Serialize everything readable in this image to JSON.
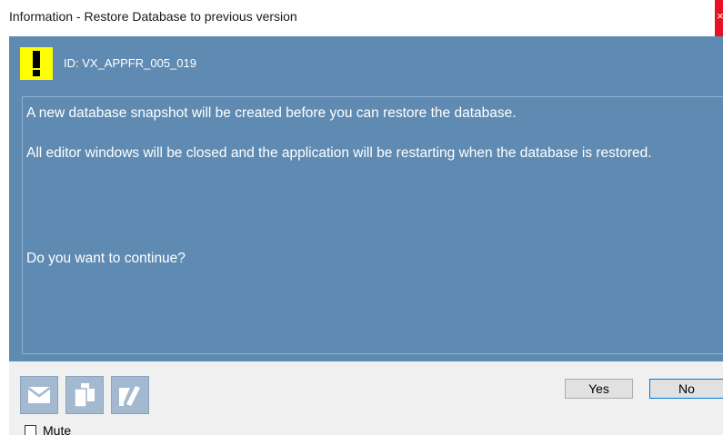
{
  "window": {
    "title": "Information - Restore Database to previous version",
    "close_glyph": "×"
  },
  "header": {
    "icon": "warning-exclamation-icon",
    "icon_color": "#ffff00",
    "message_id": "ID: VX_APPFR_005_019"
  },
  "message": {
    "line1": "A new database snapshot will be created before you can restore the database.",
    "line2": "All editor windows will be closed and the application will be restarting when the database is restored.",
    "line3": "Do you want to continue?"
  },
  "footer": {
    "tools": [
      {
        "icon": "mail-icon"
      },
      {
        "icon": "copy-icon"
      },
      {
        "icon": "edit-note-icon"
      }
    ],
    "yes_label": "Yes",
    "no_label": "No",
    "mute_label": "Mute",
    "mute_checked": false
  },
  "colors": {
    "panel": "#5f8bb3",
    "footer": "#f0f0f0",
    "close": "#e81123",
    "default_button_border": "#0078d7"
  }
}
